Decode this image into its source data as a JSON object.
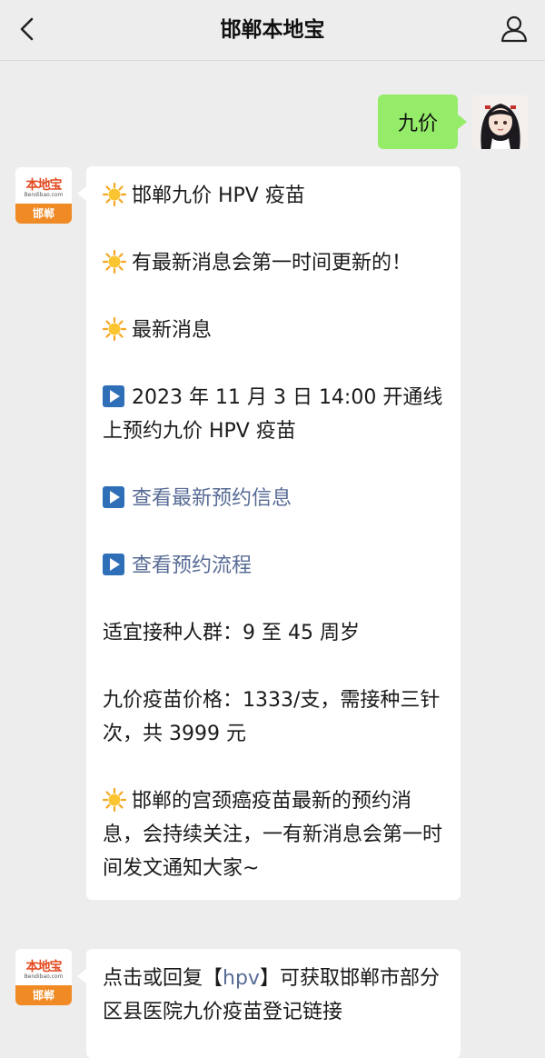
{
  "header": {
    "title": "邯郸本地宝",
    "back_icon": "back-arrow-icon",
    "profile_icon": "person-icon"
  },
  "colors": {
    "background": "#ededed",
    "outgoing_bubble": "#95ec69",
    "incoming_bubble": "#ffffff",
    "link": "#576b95",
    "brand_orange": "#f08a25"
  },
  "outgoing": {
    "text": "九价"
  },
  "bot_avatar": {
    "logo_text": "本地宝",
    "logo_url": "Bendibao.com",
    "city": "邯郸"
  },
  "message1": {
    "p1": "邯郸九价 HPV 疫苗",
    "p2": "有最新消息会第一时间更新的！",
    "p3": "最新消息",
    "p4": "2023 年 11 月 3 日 14:00 开通线上预约九价 HPV 疫苗",
    "link1": "查看最新预约信息",
    "link2": "查看预约流程",
    "p7": "适宜接种人群：9 至 45 周岁",
    "p8": "九价疫苗价格：1333/支，需接种三针次，共 3999 元",
    "p9": "邯郸的宫颈癌疫苗最新的预约消息，会持续关注，一有新消息会第一时间发文通知大家~"
  },
  "message2": {
    "text_before": "点击或回复【",
    "keyword": "hpv",
    "text_after": "】可获取邯郸市部分区县医院九价疫苗登记链接"
  }
}
